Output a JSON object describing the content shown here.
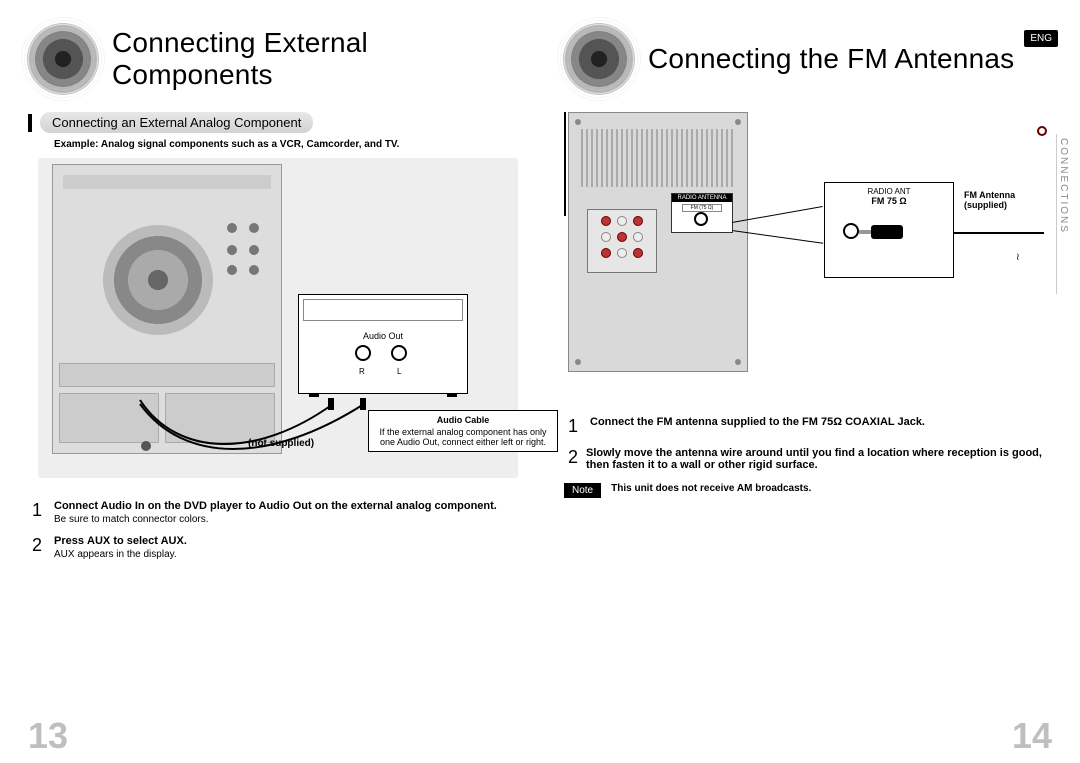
{
  "left": {
    "title": "Connecting External Components",
    "section_header": "Connecting an External Analog Component",
    "example_line": "Example: Analog signal components such as a VCR, Camcorder, and TV.",
    "audio_out_label": "Audio Out",
    "jack_r": "R",
    "jack_l": "L",
    "not_supplied": "(not supplied)",
    "cable_note_header": "Audio Cable",
    "cable_note_body": "If the external analog component has only one Audio Out, connect either left or right.",
    "steps": [
      {
        "num": "1",
        "main": "Connect Audio In on the DVD player to Audio Out on the external analog component.",
        "sub": "Be sure to match connector colors."
      },
      {
        "num": "2",
        "main_pre": "Press ",
        "main_mid": "AUX",
        "main_post": " to select AUX.",
        "sub_pre": "AUX",
        "sub_post": " appears in the display."
      }
    ],
    "page_number": "13"
  },
  "right": {
    "title": "Connecting the FM Antennas",
    "lang_badge": "ENG",
    "side_tab": "CONNECTIONS",
    "panel_radio_header": "RADIO ANTENNA",
    "panel_radio_sub": "FM (75 Ω)",
    "callout_header": "RADIO ANT",
    "callout_label": "FM 75 Ω",
    "fm_supplied": "FM Antenna (supplied)",
    "steps": [
      {
        "num": "1",
        "main": "Connect the FM antenna supplied to the FM 75Ω COAXIAL Jack."
      },
      {
        "num": "2",
        "main": "Slowly move the antenna wire around until you find a location where reception is good, then fasten it to a wall or other rigid surface."
      }
    ],
    "note_badge": "Note",
    "note_text": "This unit does not receive AM broadcasts.",
    "page_number": "14"
  }
}
